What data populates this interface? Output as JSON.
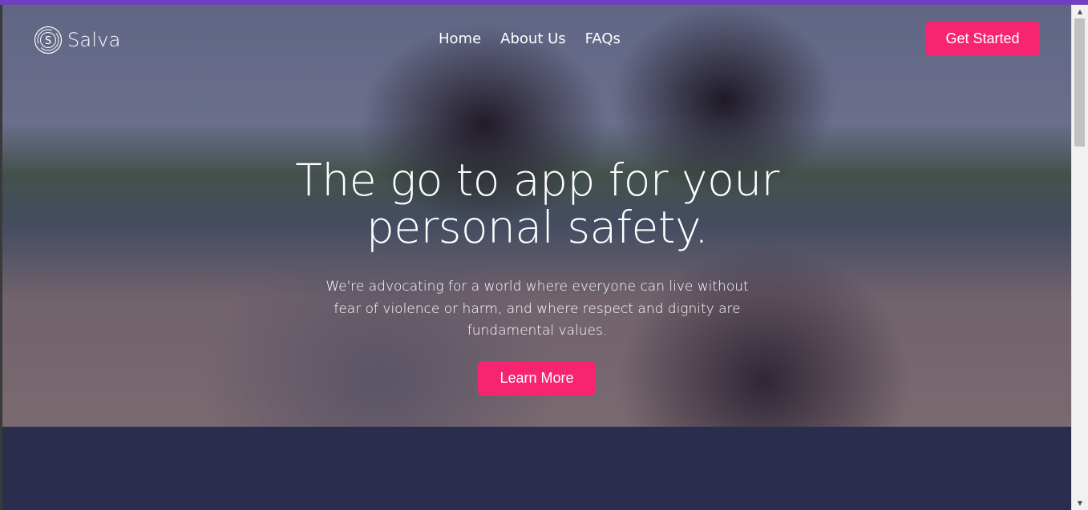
{
  "brand": {
    "name": "Salva",
    "icon": "salva-logo-icon"
  },
  "nav": {
    "items": [
      "Home",
      "About Us",
      "FAQs"
    ]
  },
  "header": {
    "cta_label": "Get Started"
  },
  "hero": {
    "headline": "The go to app for your personal safety.",
    "subtext": "We're advocating for a world where everyone can live without fear of violence or harm, and where respect and dignity are fundamental values.",
    "cta_label": "Learn More"
  },
  "colors": {
    "accent": "#f7256f",
    "top_bar": "#6f3fc1",
    "section_bg": "#2a2d4e"
  }
}
